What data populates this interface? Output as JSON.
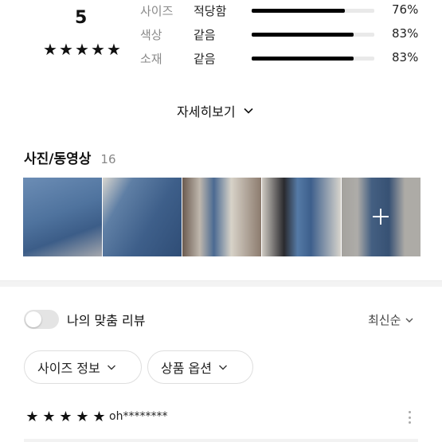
{
  "summary": {
    "score": "5",
    "stars": [
      "★",
      "★",
      "★",
      "★",
      "★"
    ],
    "metrics": [
      {
        "label": "사이즈",
        "value": "적당함",
        "percent_text": "76%",
        "percent": 76
      },
      {
        "label": "색상",
        "value": "같음",
        "percent_text": "83%",
        "percent": 83
      },
      {
        "label": "소재",
        "value": "같음",
        "percent_text": "83%",
        "percent": 83
      }
    ]
  },
  "more": {
    "label": "자세히보기"
  },
  "media": {
    "title": "사진/동영상",
    "count": "16"
  },
  "filters": {
    "toggle_label": "나의 맞춤 리뷰",
    "toggle_on": false,
    "sort_label": "최신순",
    "chips": [
      {
        "label": "사이즈 정보"
      },
      {
        "label": "상품 옵션"
      }
    ]
  },
  "review": {
    "stars": [
      "★",
      "★",
      "★",
      "★",
      "★"
    ],
    "author": "oh********"
  },
  "colors": {
    "bar_fill": "#000000",
    "bar_track": "#e9e9e9",
    "muted_text": "#8a8a8a"
  }
}
